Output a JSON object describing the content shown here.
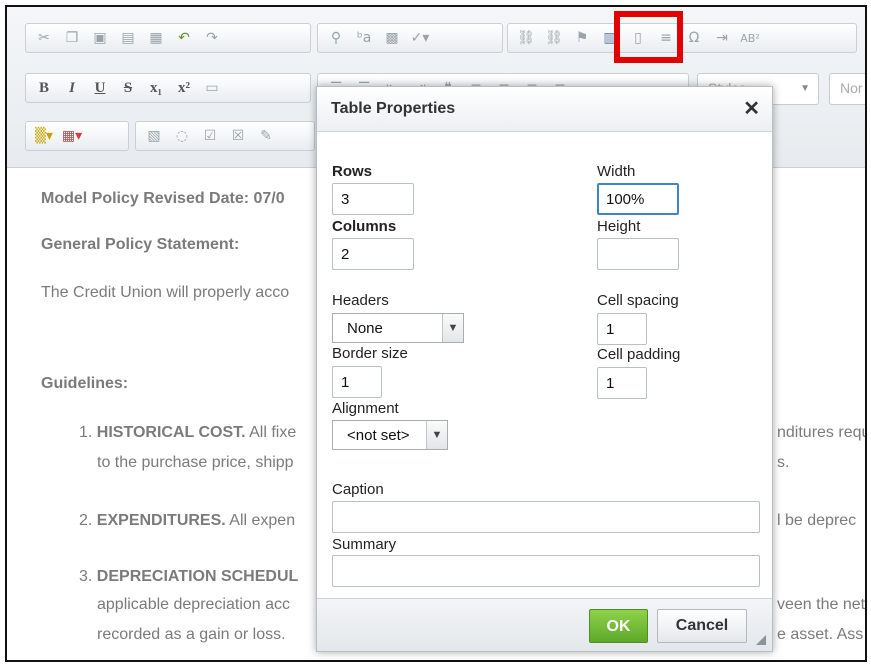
{
  "toolbar": {
    "row1": [
      "scissors-icon",
      "copy-icon",
      "paste-icon",
      "paste-text-icon",
      "paste-word-icon",
      "undo-icon",
      "redo-icon",
      "find-icon",
      "replace-icon",
      "select-all-icon",
      "spellcheck-icon",
      "link-icon",
      "unlink-icon",
      "anchor-icon",
      "table-icon",
      "horizontal-line-icon",
      "special-char-icon",
      "page-break-icon",
      "superscript-ab-icon"
    ],
    "format_buttons": [
      "B",
      "I",
      "U",
      "S",
      "x₁",
      "x²"
    ],
    "styles_label": "Styles",
    "format_label": "Nor"
  },
  "document": {
    "line1": "Model Policy Revised Date: 07/0",
    "line2": "General Policy Statement:",
    "line3": "The Credit Union will properly acco",
    "guidelines": "Guidelines:",
    "item1_num": "1.",
    "item1_bold": "HISTORICAL COST.",
    "item1_text": " All fixe",
    "item1_right": "nditures requ",
    "item1_line2": "to the purchase price, shipp",
    "item1_line2_right": "s.",
    "item2_num": "2.",
    "item2_bold": "EXPENDITURES.",
    "item2_text": " All expen",
    "item2_right": "l be deprec",
    "item3_num": "3.",
    "item3_bold": "DEPRECIATION SCHEDUL",
    "item3_line2": "applicable depreciation acc",
    "item3_line2_right": "veen the net",
    "item3_line3": "recorded as a gain or loss.",
    "item3_line3_right": "e asset. Ass"
  },
  "dialog": {
    "title": "Table Properties",
    "close": "✕",
    "rows_label": "Rows",
    "rows_value": "3",
    "columns_label": "Columns",
    "columns_value": "2",
    "width_label": "Width",
    "width_value": "100%",
    "height_label": "Height",
    "height_value": "",
    "headers_label": "Headers",
    "headers_value": "None",
    "cell_spacing_label": "Cell spacing",
    "cell_spacing_value": "1",
    "border_size_label": "Border size",
    "border_size_value": "1",
    "cell_padding_label": "Cell padding",
    "cell_padding_value": "1",
    "alignment_label": "Alignment",
    "alignment_value": "<not set>",
    "caption_label": "Caption",
    "caption_value": "",
    "summary_label": "Summary",
    "summary_value": "",
    "ok_label": "OK",
    "cancel_label": "Cancel"
  },
  "colors": {
    "highlight": "#e30000",
    "ok_green": "#6ab531",
    "focus_blue": "#3f83c8"
  }
}
